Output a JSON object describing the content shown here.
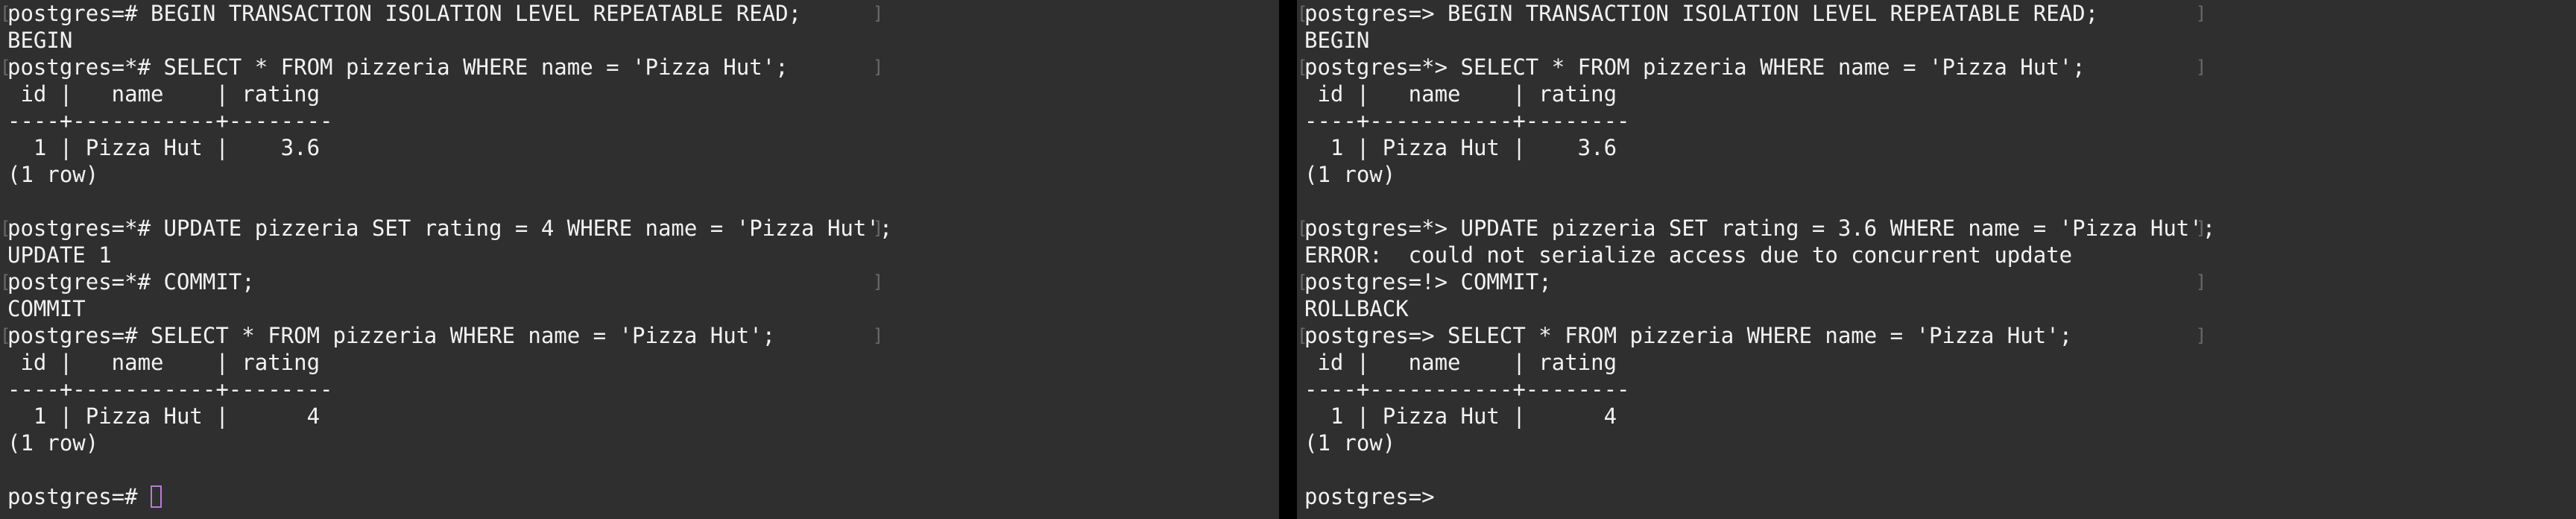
{
  "left_terminal": {
    "lines": [
      {
        "text": "postgres=# BEGIN TRANSACTION ISOLATION LEVEL REPEATABLE READ;",
        "marked": true
      },
      {
        "text": "BEGIN",
        "marked": false
      },
      {
        "text": "postgres=*# SELECT * FROM pizzeria WHERE name = 'Pizza Hut';",
        "marked": true
      },
      {
        "text": " id |   name    | rating",
        "marked": false
      },
      {
        "text": "----+-----------+--------",
        "marked": false
      },
      {
        "text": "  1 | Pizza Hut |    3.6",
        "marked": false
      },
      {
        "text": "(1 row)",
        "marked": false
      },
      {
        "text": "",
        "marked": false
      },
      {
        "text": "postgres=*# UPDATE pizzeria SET rating = 4 WHERE name = 'Pizza Hut';",
        "marked": true
      },
      {
        "text": "UPDATE 1",
        "marked": false
      },
      {
        "text": "postgres=*# COMMIT;",
        "marked": true
      },
      {
        "text": "COMMIT",
        "marked": false
      },
      {
        "text": "postgres=# SELECT * FROM pizzeria WHERE name = 'Pizza Hut';",
        "marked": true
      },
      {
        "text": " id |   name    | rating",
        "marked": false
      },
      {
        "text": "----+-----------+--------",
        "marked": false
      },
      {
        "text": "  1 | Pizza Hut |      4",
        "marked": false
      },
      {
        "text": "(1 row)",
        "marked": false
      },
      {
        "text": "",
        "marked": false
      }
    ],
    "prompt": "postgres=# "
  },
  "right_terminal": {
    "lines": [
      {
        "text": "postgres=> BEGIN TRANSACTION ISOLATION LEVEL REPEATABLE READ;",
        "marked": true
      },
      {
        "text": "BEGIN",
        "marked": false
      },
      {
        "text": "postgres=*> SELECT * FROM pizzeria WHERE name = 'Pizza Hut';",
        "marked": true
      },
      {
        "text": " id |   name    | rating",
        "marked": false
      },
      {
        "text": "----+-----------+--------",
        "marked": false
      },
      {
        "text": "  1 | Pizza Hut |    3.6",
        "marked": false
      },
      {
        "text": "(1 row)",
        "marked": false
      },
      {
        "text": "",
        "marked": false
      },
      {
        "text": "postgres=*> UPDATE pizzeria SET rating = 3.6 WHERE name = 'Pizza Hut';",
        "marked": true
      },
      {
        "text": "ERROR:  could not serialize access due to concurrent update",
        "marked": false
      },
      {
        "text": "postgres=!> COMMIT;",
        "marked": true
      },
      {
        "text": "ROLLBACK",
        "marked": false
      },
      {
        "text": "postgres=> SELECT * FROM pizzeria WHERE name = 'Pizza Hut';",
        "marked": true
      },
      {
        "text": " id |   name    | rating",
        "marked": false
      },
      {
        "text": "----+-----------+--------",
        "marked": false
      },
      {
        "text": "  1 | Pizza Hut |      4",
        "marked": false
      },
      {
        "text": "(1 row)",
        "marked": false
      },
      {
        "text": "",
        "marked": false
      }
    ],
    "prompt": "postgres=> "
  },
  "colors": {
    "pane_background": "#2f2f2f",
    "divider": "#000000",
    "text": "#f2f2f2",
    "cursor": "#b57cd6"
  }
}
